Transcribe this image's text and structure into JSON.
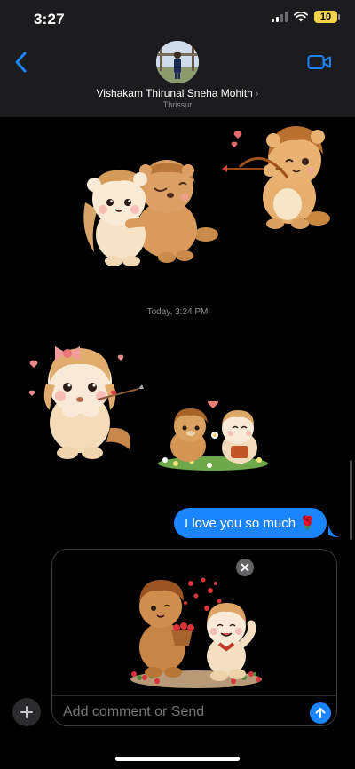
{
  "status_bar": {
    "time": "3:27",
    "battery": "10"
  },
  "header": {
    "contact_name": "Vishakam Thirunal Sneha Mohith",
    "chevron": "›",
    "location": "Thrissur"
  },
  "messages": {
    "stickers": [
      {
        "name": "hugging-bears-sticker"
      },
      {
        "name": "cupid-bear-sticker"
      },
      {
        "name": "bow-heart-bear-sticker"
      },
      {
        "name": "garden-bears-sticker"
      }
    ],
    "timestamp": "Today, 3:24 PM",
    "sent_text": "I love you so much 🌹"
  },
  "compose": {
    "placeholder": "Add comment or Send",
    "attachment": "flower-basket-bears-sticker"
  },
  "icons": {
    "back": "chevron-left-icon",
    "video": "video-camera-icon",
    "remove": "close-icon",
    "send": "arrow-up-icon",
    "add": "plus-icon"
  },
  "colors": {
    "header_bg": "#1c1c1e",
    "accent_blue": "#1b84ff",
    "battery": "#f2d34a",
    "muted": "#8e8e93"
  }
}
